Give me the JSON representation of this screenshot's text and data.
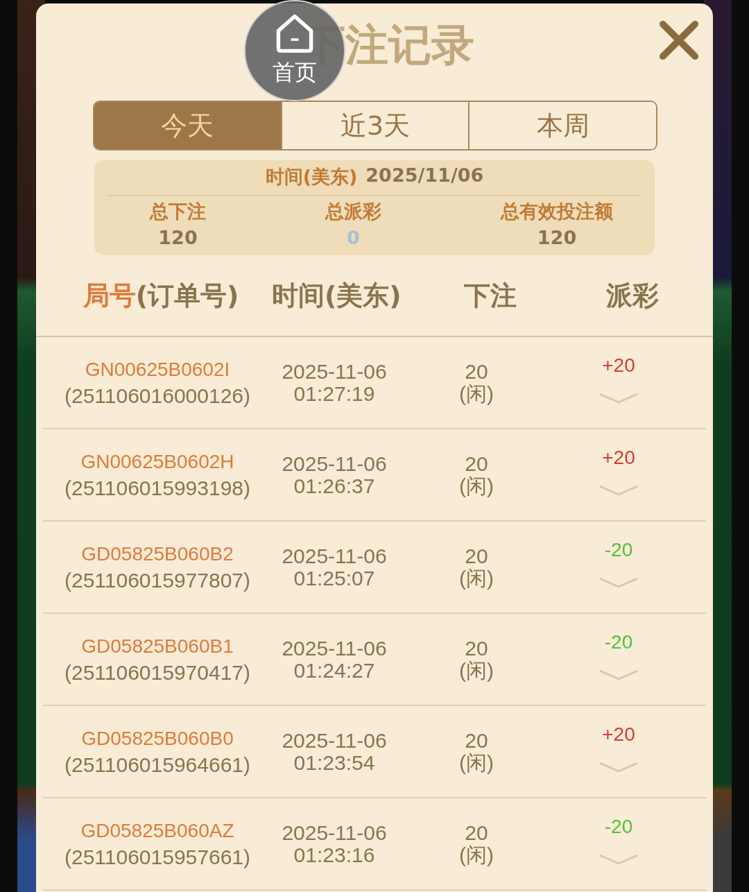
{
  "floating_button": {
    "label": "首页"
  },
  "dialog": {
    "title": "下注记录"
  },
  "tabs": [
    {
      "label": "今天",
      "selected": true
    },
    {
      "label": "近3天",
      "selected": false
    },
    {
      "label": "本周",
      "selected": false
    }
  ],
  "summary": {
    "date_label": "时间(美东)",
    "date": "2025/11/06",
    "stats": [
      {
        "label": "总下注",
        "value": "120",
        "muted": false
      },
      {
        "label": "总派彩",
        "value": "0",
        "muted": true
      },
      {
        "label": "总有效投注额",
        "value": "120",
        "muted": false
      }
    ]
  },
  "table": {
    "columns": [
      {
        "title": "局号",
        "subtitle": "(订单号)"
      },
      {
        "title": "时间(美东)"
      },
      {
        "title": "下注"
      },
      {
        "title": "派彩"
      }
    ],
    "rows": [
      {
        "round": "GN00625B0602I",
        "order": "(251106016000126)",
        "date": "2025-11-06",
        "time": "01:27:19",
        "bet": "20",
        "side": "(闲)",
        "payout": "+20",
        "kind": "win",
        "expanded": false
      },
      {
        "round": "GN00625B0602H",
        "order": "(251106015993198)",
        "date": "2025-11-06",
        "time": "01:26:37",
        "bet": "20",
        "side": "(闲)",
        "payout": "+20",
        "kind": "win",
        "expanded": false
      },
      {
        "round": "GD05825B060B2",
        "order": "(251106015977807)",
        "date": "2025-11-06",
        "time": "01:25:07",
        "bet": "20",
        "side": "(闲)",
        "payout": "-20",
        "kind": "loss",
        "expanded": false
      },
      {
        "round": "GD05825B060B1",
        "order": "(251106015970417)",
        "date": "2025-11-06",
        "time": "01:24:27",
        "bet": "20",
        "side": "(闲)",
        "payout": "-20",
        "kind": "loss",
        "expanded": false
      },
      {
        "round": "GD05825B060B0",
        "order": "(251106015964661)",
        "date": "2025-11-06",
        "time": "01:23:54",
        "bet": "20",
        "side": "(闲)",
        "payout": "+20",
        "kind": "win",
        "expanded": false
      },
      {
        "round": "GD05825B060AZ",
        "order": "(251106015957661)",
        "date": "2025-11-06",
        "time": "01:23:16",
        "bet": "20",
        "side": "(闲)",
        "payout": "-20",
        "kind": "loss",
        "expanded": false
      }
    ]
  }
}
